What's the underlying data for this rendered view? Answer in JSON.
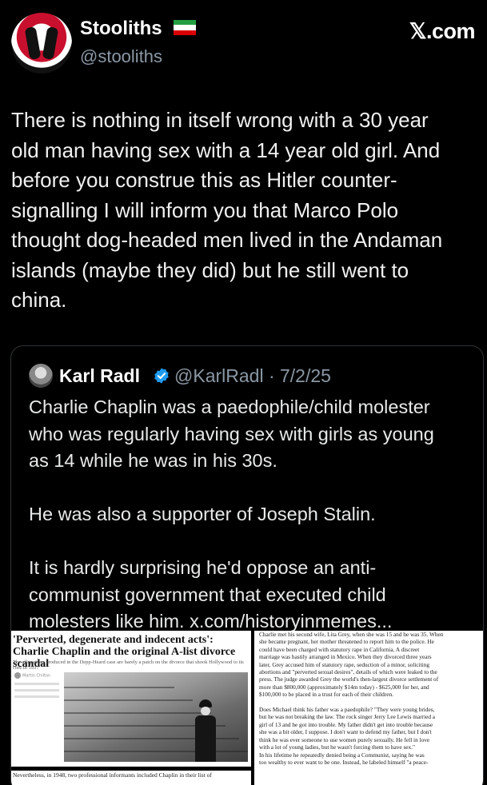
{
  "author": {
    "display_name": "Stooliths",
    "handle": "@stooliths",
    "flag_icon": "iran-flag-icon",
    "flag_colors": [
      "#239f40",
      "#ffffff",
      "#da0000"
    ]
  },
  "brand": {
    "label": "𝕏.com"
  },
  "tweet": {
    "text": "There is nothing in itself wrong with a 30 year\nold man having sex with a 14 year old girl. And\nbefore you construe this as Hitler counter-\nsignalling I will inform you that Marco Polo\nthought dog-headed men lived in the Andaman\nislands (maybe they did) but he still went to\nchina."
  },
  "quote": {
    "display_name": "Karl Radl",
    "verified_icon": "verified-badge-icon",
    "verified_color": "#1d9bf0",
    "handle_date": "@KarlRadl · 7/2/25",
    "text": "Charlie Chaplin was a paedophile/child molester\nwho was regularly having sex with girls as young\nas 14 while he was in his 30s.\n\nHe was also a supporter of Joseph Stalin.\n\nIt is hardly surprising he'd oppose an anti-\ncommunist government that executed child\nmolesters like him. x.com/historyinmemes..."
  },
  "media": {
    "left_headline": "'Perverted, degenerate and indecent acts': Charlie Chaplin and the original A-list divorce scandal",
    "left_subhead": "The allegations produced in the Depp-Heard case are barely a patch on the divorce that shook Hollywood to its core in 1937",
    "left_author": "Martin Chilton",
    "left_lower": "Nevertheless, in 1948, two professional informants included Chaplin in their list of",
    "right_text": "Charlie met his second wife, Lita Grey, when she was 15 and he was 35. When\nshe became pregnant, her mother threatened to report him to the police. He\ncould have been charged with statutory rape in California. A discreet\nmarriage was hastily arranged in Mexico. When they divorced three years\nlater, Grey accused him of statutory rape, seduction of a minor, soliciting\nabortions and \"perverted sexual desires\", details of which were leaked to the\npress. The judge awarded Grey the world's then-largest divorce settlement of\nmore than $800,000 (approximately $14m today) - $625,000 for her, and\n$100,000 to be placed in a trust for each of their children.\n\nDoes Michael think his father was a paedophile? \"They were young brides,\nbut he was not breaking the law. The rock singer Jerry Lee Lewis married a\ngirl of 13 and he got into trouble. My father didn't get into trouble because\nshe was a bit older, I suppose. I don't want to defend my father, but I don't\nthink he was ever someone to use women purely sexually. He fell in love\nwith a lot of young ladies, but he wasn't forcing them to have sex.\"\nIn his lifetime he repeatedly denied being a Communist, saying he was\ntoo wealthy to ever want to be one. Instead, he labeled himself \"a peace-"
  }
}
